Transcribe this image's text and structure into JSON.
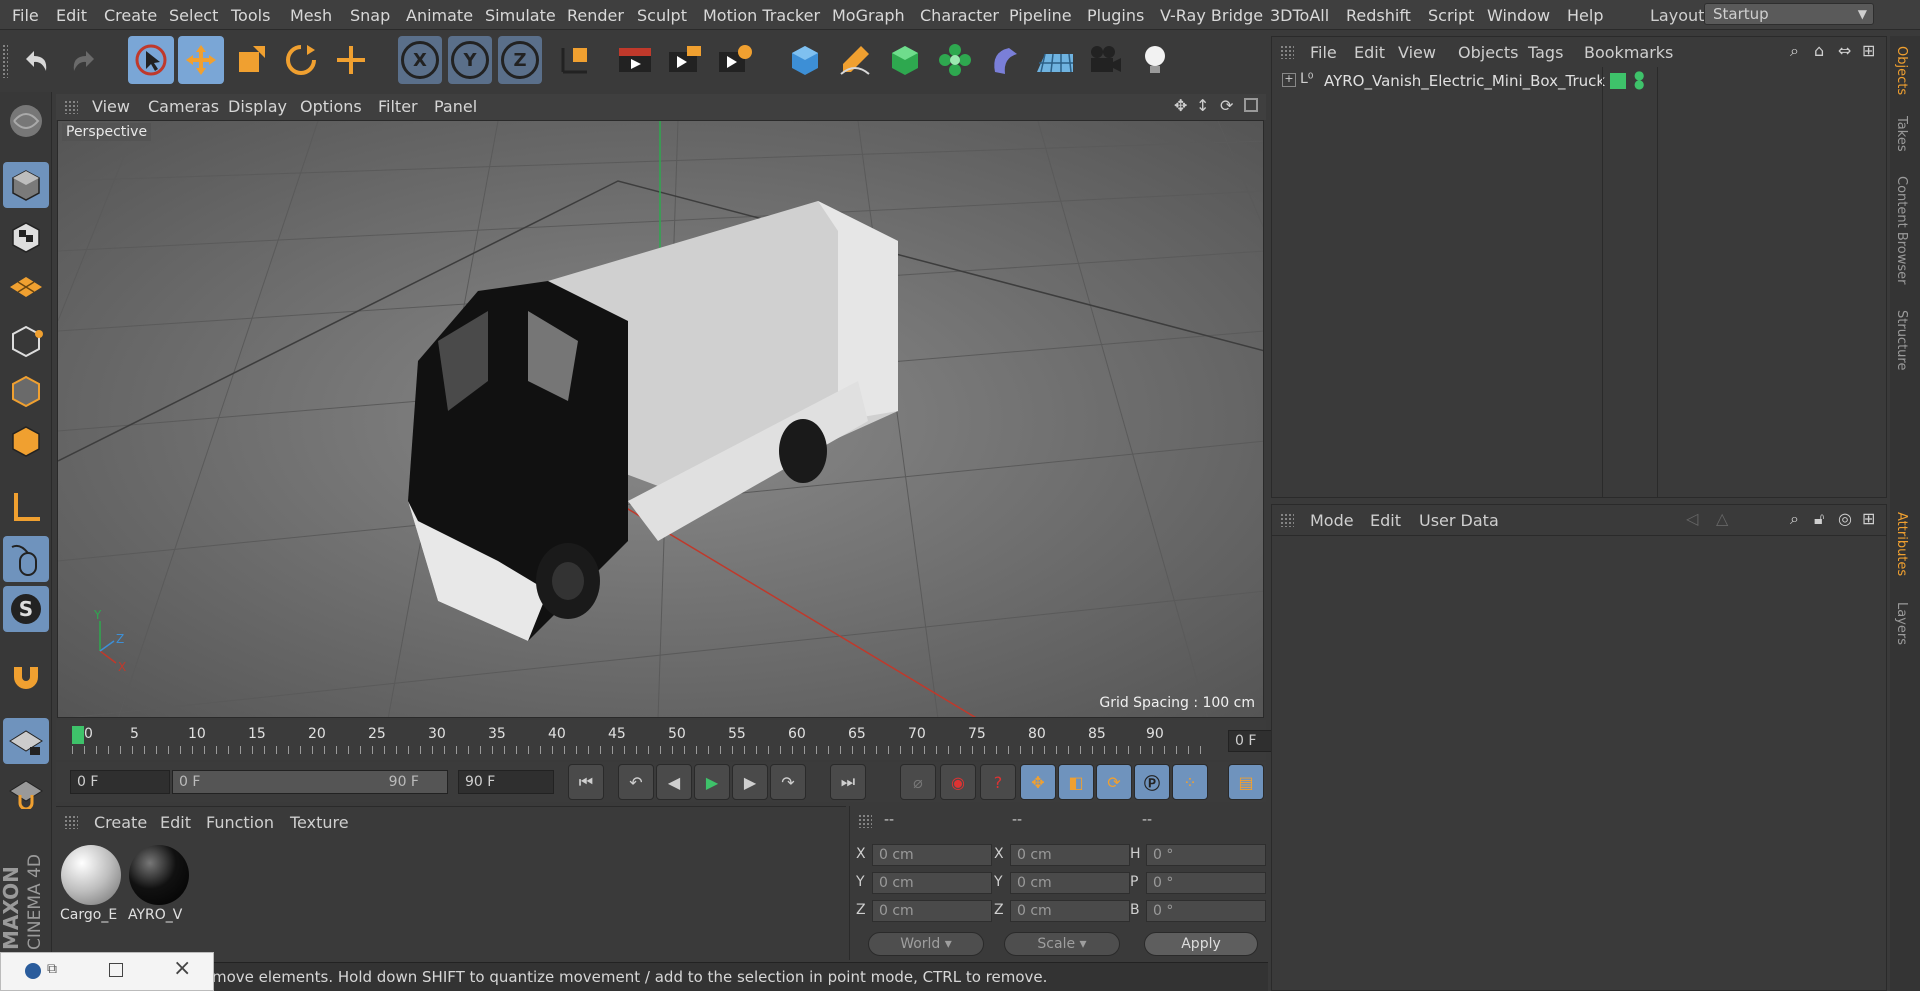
{
  "menubar": {
    "items": [
      "File",
      "Edit",
      "Create",
      "Select",
      "Tools",
      "Mesh",
      "Snap",
      "Animate",
      "Simulate",
      "Render",
      "Sculpt",
      "Motion Tracker",
      "MoGraph",
      "Character",
      "Pipeline",
      "Plugins",
      "V-Ray Bridge",
      "3DToAll",
      "Redshift",
      "Script",
      "Window",
      "Help"
    ],
    "layout_label": "Layout:",
    "layout_value": "Startup"
  },
  "toolbar": {
    "axis_x": "X",
    "axis_y": "Y",
    "axis_z": "Z"
  },
  "viewport": {
    "menu": [
      "View",
      "Cameras",
      "Display",
      "Options",
      "Filter",
      "Panel"
    ],
    "camera_label": "Perspective",
    "grid_spacing": "Grid Spacing : 100 cm",
    "axis_labels": {
      "x": "X",
      "y": "Y",
      "z": "Z"
    }
  },
  "timeline": {
    "ticks": [
      "0",
      "5",
      "10",
      "15",
      "20",
      "25",
      "30",
      "35",
      "40",
      "45",
      "50",
      "55",
      "60",
      "65",
      "70",
      "75",
      "80",
      "85",
      "90"
    ],
    "current_frame": "0 F"
  },
  "transport": {
    "start_frame": "0 F",
    "range_start": "0 F",
    "range_end": "90 F",
    "end_frame": "90 F"
  },
  "materials": {
    "menu": [
      "Create",
      "Edit",
      "Function",
      "Texture"
    ],
    "items": [
      {
        "name": "Cargo_E"
      },
      {
        "name": "AYRO_V"
      }
    ]
  },
  "coordinates": {
    "header": [
      "--",
      "--",
      "--"
    ],
    "rows": [
      {
        "l1": "X",
        "v1": "0 cm",
        "l2": "X",
        "v2": "0 cm",
        "l3": "H",
        "v3": "0 °"
      },
      {
        "l1": "Y",
        "v1": "0 cm",
        "l2": "Y",
        "v2": "0 cm",
        "l3": "P",
        "v3": "0 °"
      },
      {
        "l1": "Z",
        "v1": "0 cm",
        "l2": "Z",
        "v2": "0 cm",
        "l3": "B",
        "v3": "0 °"
      }
    ],
    "mode_world": "World",
    "mode_scale": "Scale",
    "apply": "Apply"
  },
  "status": {
    "text": "move elements. Hold down SHIFT to quantize movement / add to the selection in point mode, CTRL to remove."
  },
  "object_manager": {
    "menu": [
      "File",
      "Edit",
      "View",
      "Objects",
      "Tags",
      "Bookmarks"
    ],
    "objects": [
      {
        "name": "AYRO_Vanish_Electric_Mini_Box_Truck"
      }
    ]
  },
  "attribute_manager": {
    "menu": [
      "Mode",
      "Edit",
      "User Data"
    ]
  },
  "side_tabs": [
    "Objects",
    "Takes",
    "Content Browser",
    "Structure",
    "Attributes",
    "Layers"
  ],
  "branding": {
    "maxon": "MAXON",
    "product": "CINEMA 4D"
  },
  "colors": {
    "accent": "#f0a030",
    "highlight": "#7aa6d6",
    "play": "#3ec26a",
    "status_green": "#3ec26a"
  }
}
